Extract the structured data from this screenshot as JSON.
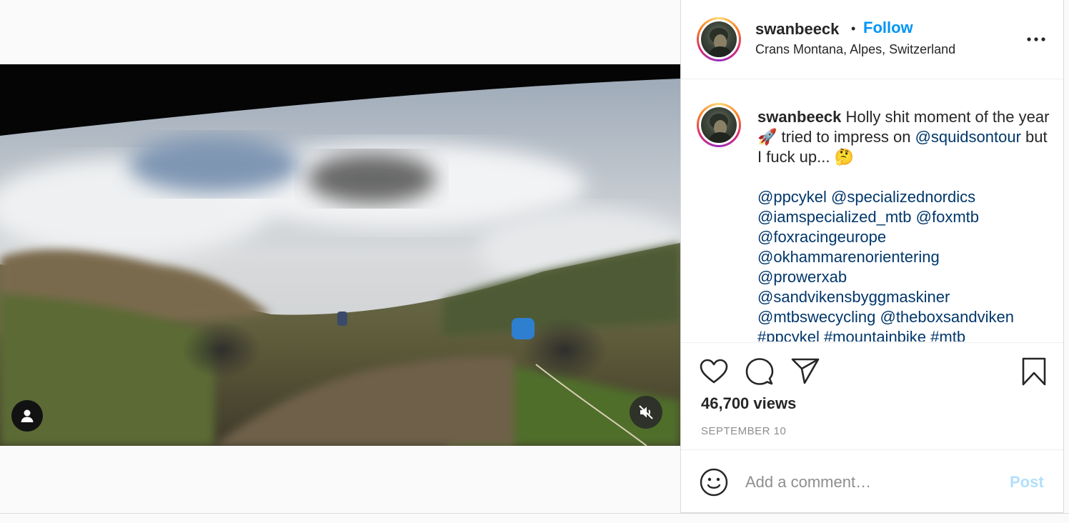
{
  "post": {
    "username": "swanbeeck",
    "separator": "•",
    "follow_label": "Follow",
    "location": "Crans Montana, Alpes, Switzerland",
    "more_icon": "more-horizontal-icon"
  },
  "caption": {
    "username": "swanbeeck",
    "text_1": " Holly shit moment of the year ",
    "rocket_emoji": "🚀",
    "text_2": " tried to impress on ",
    "mention_squids": "@squidsontour",
    "text_3": " but I fuck up... ",
    "thinking_emoji": "🤔",
    "tags": [
      "@ppcykel @specializednordics",
      "@iamspecialized_mtb @foxmtb",
      "@foxracingeurope",
      "@okhammarenorientering",
      "@prowerxab",
      "@sandvikensbyggmaskiner",
      "@mtbswecycling @theboxsandviken",
      "#ppcykel #mountainbike #mtb"
    ]
  },
  "actions": {
    "like_icon": "heart-icon",
    "comment_icon": "comment-bubble-icon",
    "share_icon": "paper-plane-icon",
    "save_icon": "bookmark-icon",
    "views": "46,700 views",
    "date": "SEPTEMBER 10"
  },
  "comment_box": {
    "emoji_icon": "emoji-smiley-icon",
    "placeholder": "Add a comment…",
    "post_label": "Post"
  },
  "video": {
    "user_tag_icon": "person-icon",
    "mute_icon": "speaker-muted-icon"
  },
  "colors": {
    "accent_blue": "#0095f6",
    "link_blue": "#00376b",
    "post_disabled": "#b2dffc",
    "muted_text": "#8e8e8e"
  }
}
